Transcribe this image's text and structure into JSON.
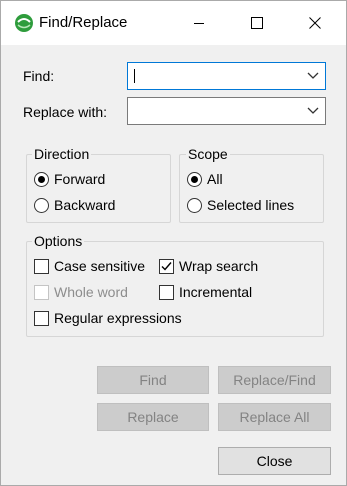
{
  "window": {
    "title": "Find/Replace",
    "app_icon": "eclipse-icon",
    "controls": [
      "minimize-icon",
      "maximize-icon",
      "close-icon"
    ]
  },
  "fields": {
    "find_label": "Find:",
    "find_value": "",
    "replace_label": "Replace with:",
    "replace_value": ""
  },
  "direction": {
    "title": "Direction",
    "options": [
      {
        "label": "Forward",
        "selected": true
      },
      {
        "label": "Backward",
        "selected": false
      }
    ]
  },
  "scope": {
    "title": "Scope",
    "options": [
      {
        "label": "All",
        "selected": true
      },
      {
        "label": "Selected lines",
        "selected": false
      }
    ]
  },
  "options": {
    "title": "Options",
    "case_sensitive": {
      "label": "Case sensitive",
      "checked": false,
      "enabled": true
    },
    "wrap_search": {
      "label": "Wrap search",
      "checked": true,
      "enabled": true
    },
    "whole_word": {
      "label": "Whole word",
      "checked": false,
      "enabled": false
    },
    "incremental": {
      "label": "Incremental",
      "checked": false,
      "enabled": true
    },
    "regular_expressions": {
      "label": "Regular expressions",
      "checked": false,
      "enabled": true
    }
  },
  "buttons": {
    "find": {
      "label": "Find",
      "enabled": false
    },
    "replace_find": {
      "label": "Replace/Find",
      "enabled": false
    },
    "replace": {
      "label": "Replace",
      "enabled": false
    },
    "replace_all": {
      "label": "Replace All",
      "enabled": false
    },
    "close": {
      "label": "Close",
      "enabled": true
    }
  },
  "colors": {
    "focus_border": "#0078d7",
    "app_icon_green": "#2e9c3c",
    "dialog_bg": "#f0f0f0"
  }
}
